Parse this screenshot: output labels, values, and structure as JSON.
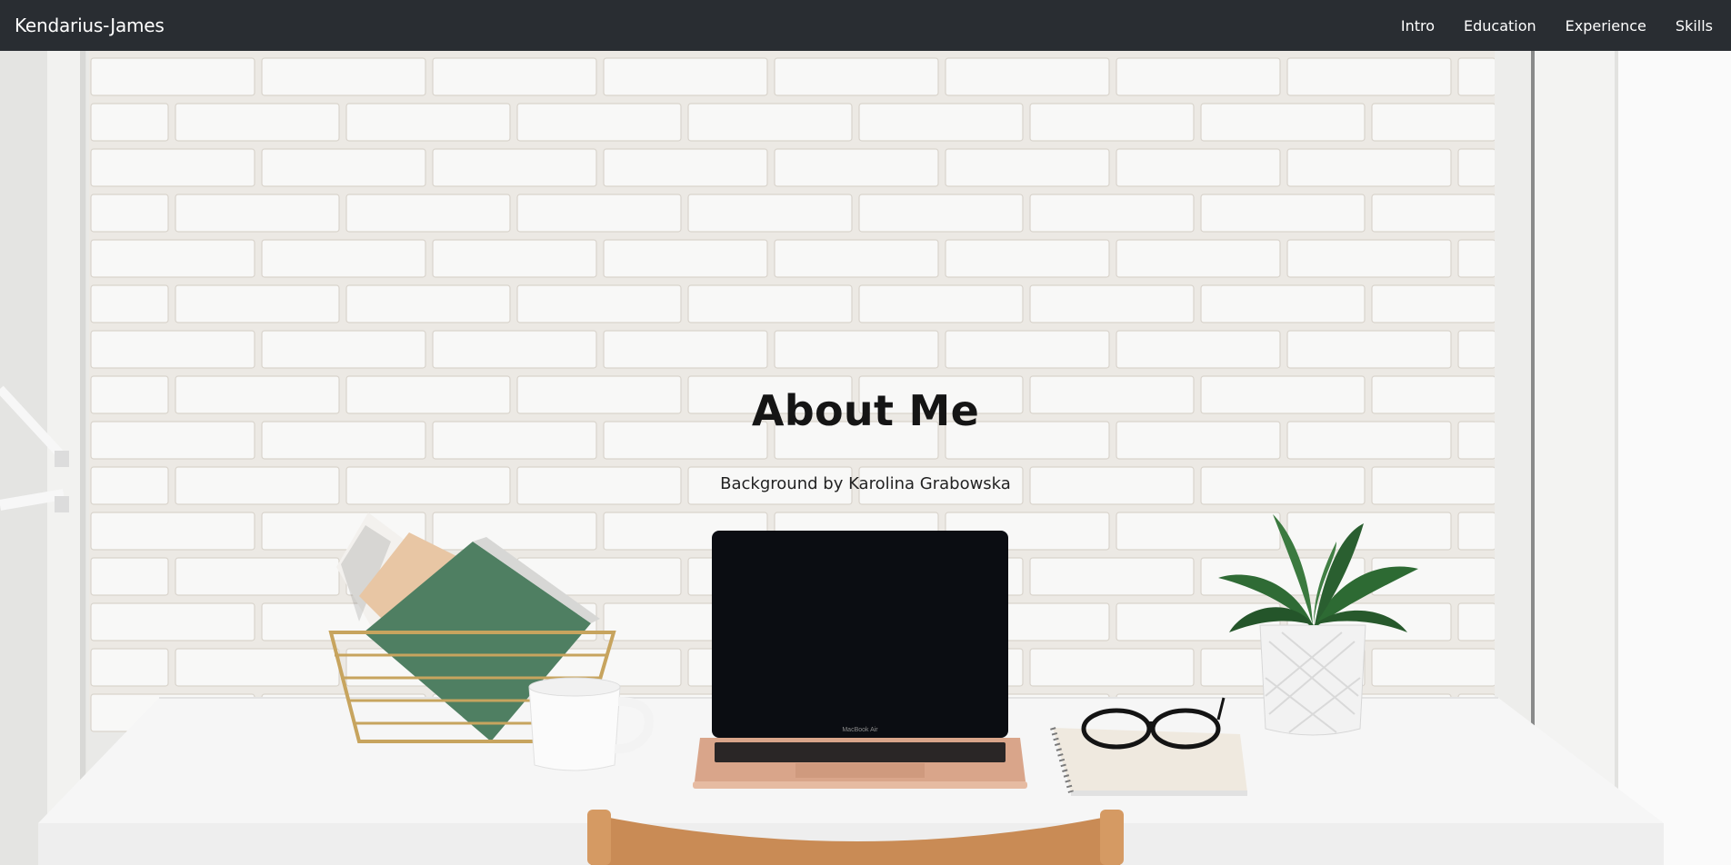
{
  "navbar": {
    "brand": "Kendarius-James",
    "links": [
      "Intro",
      "Education",
      "Experience",
      "Skills"
    ]
  },
  "hero": {
    "title": "About Me",
    "subtitle": "Background by Karolina Grabowska",
    "laptop_label": "MacBook Air"
  },
  "colors": {
    "navbar_bg": "#292d32",
    "nav_text": "#ffffff",
    "title_text": "#151515",
    "wall": "#f4f3f1",
    "desk": "#f7f7f7"
  }
}
